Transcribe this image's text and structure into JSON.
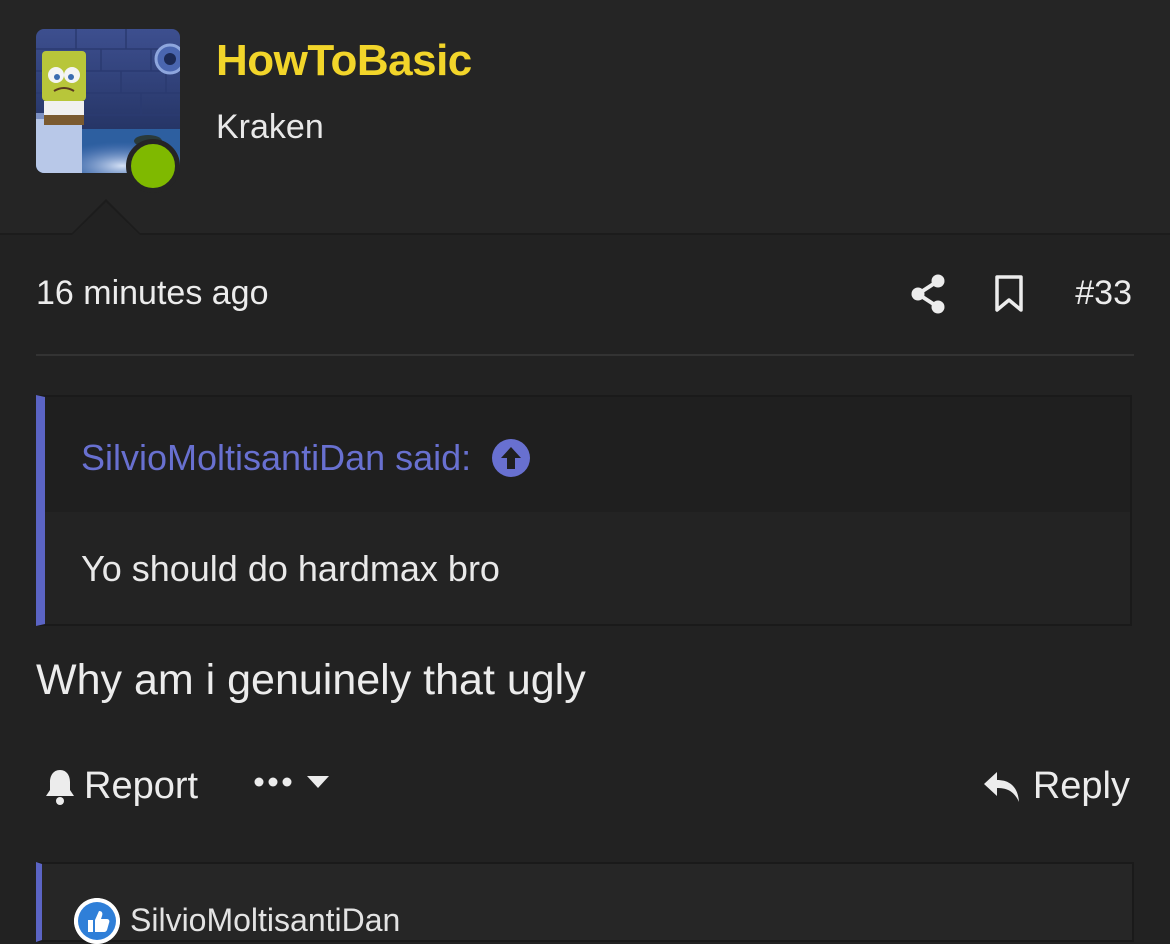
{
  "user": {
    "name": "HowToBasic",
    "title": "Kraken",
    "avatar_icon": "spongebob-avatar",
    "online_color": "#7fb900",
    "name_color": "#f2d52a"
  },
  "post": {
    "timestamp": "16 minutes ago",
    "number": "#33",
    "share_icon": "share-icon",
    "bookmark_icon": "bookmark-icon"
  },
  "quote": {
    "author_label": "SilvioMoltisantiDan said:",
    "text": "Yo should do hardmax bro",
    "accent": "#5b64c4"
  },
  "message": {
    "text": "Why am i genuinely that ugly"
  },
  "actions": {
    "report_label": "Report",
    "reply_label": "Reply"
  },
  "reactions": {
    "user": "SilvioMoltisantiDan",
    "icon": "like-icon"
  }
}
